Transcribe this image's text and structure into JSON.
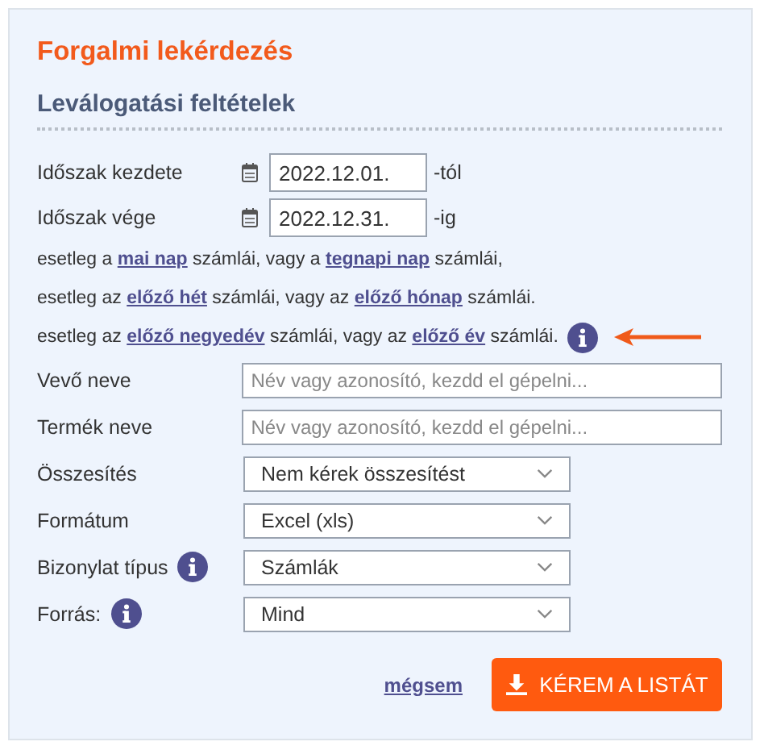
{
  "title": "Forgalmi lekérdezés",
  "subtitle": "Leválogatási feltételek",
  "date_rows": [
    {
      "label": "Időszak kezdete",
      "value": "2022.12.01.",
      "suffix": "-tól"
    },
    {
      "label": "Időszak vége",
      "value": "2022.12.31.",
      "suffix": "-ig"
    }
  ],
  "sentences": [
    {
      "parts": [
        {
          "kind": "text",
          "text": "esetleg a "
        },
        {
          "kind": "link",
          "text": "mai nap"
        },
        {
          "kind": "text",
          "text": " számlái, vagy a "
        },
        {
          "kind": "link",
          "text": "tegnapi nap"
        },
        {
          "kind": "text",
          "text": " számlái,"
        }
      ],
      "info": false,
      "arrow": false
    },
    {
      "parts": [
        {
          "kind": "text",
          "text": "esetleg az "
        },
        {
          "kind": "link",
          "text": "előző hét"
        },
        {
          "kind": "text",
          "text": " számlái, vagy az "
        },
        {
          "kind": "link",
          "text": "előző hónap"
        },
        {
          "kind": "text",
          "text": " számlái."
        }
      ],
      "info": false,
      "arrow": false
    },
    {
      "parts": [
        {
          "kind": "text",
          "text": "esetleg az "
        },
        {
          "kind": "link",
          "text": "előző negyedév"
        },
        {
          "kind": "text",
          "text": " számlái, vagy az "
        },
        {
          "kind": "link",
          "text": "előző év"
        },
        {
          "kind": "text",
          "text": " számlái."
        }
      ],
      "info": true,
      "arrow": true
    }
  ],
  "fields": [
    {
      "kind": "text",
      "label": "Vevő neve",
      "info": false,
      "placeholder": "Név vagy azonosító, kezdd el gépelni..."
    },
    {
      "kind": "text",
      "label": "Termék neve",
      "info": false,
      "placeholder": "Név vagy azonosító, kezdd el gépelni..."
    },
    {
      "kind": "select",
      "label": "Összesítés",
      "info": false,
      "value": "Nem kérek összesítést"
    },
    {
      "kind": "select",
      "label": "Formátum",
      "info": false,
      "value": "Excel (xls)"
    },
    {
      "kind": "select",
      "label": "Bizonylat típus",
      "info": true,
      "value": "Számlák"
    },
    {
      "kind": "select",
      "label": "Forrás:",
      "info": true,
      "value": "Mind"
    }
  ],
  "cancel": "mégsem",
  "submit": "KÉREM A LISTÁT"
}
